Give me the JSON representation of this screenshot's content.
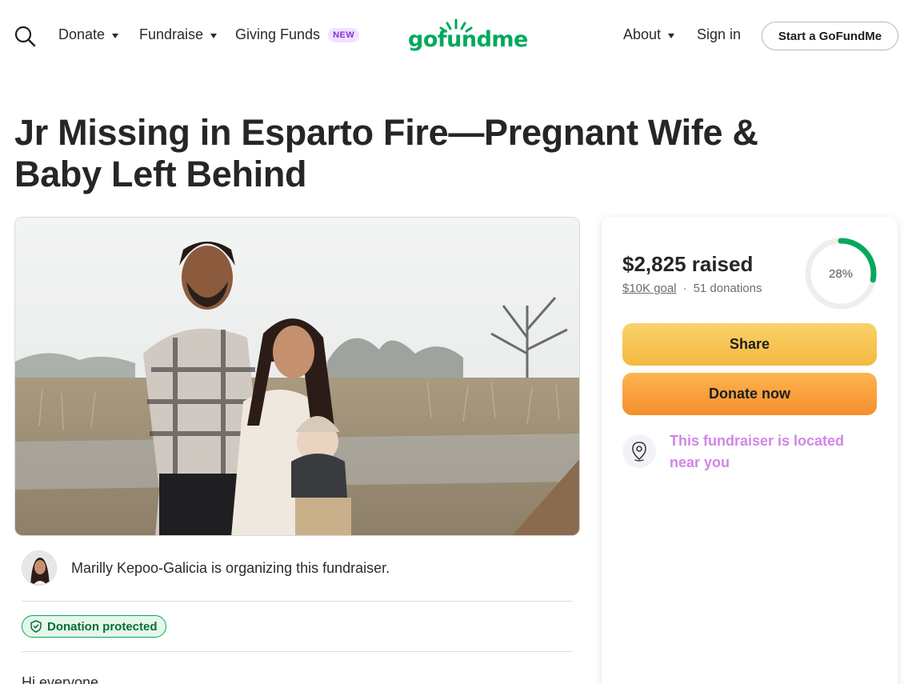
{
  "header": {
    "nav": {
      "donate": "Donate",
      "fundraise": "Fundraise",
      "giving_funds": "Giving Funds",
      "giving_funds_badge": "NEW",
      "about": "About",
      "sign_in": "Sign in"
    },
    "logo_text": "gofundme",
    "start_button": "Start a GoFundMe"
  },
  "campaign": {
    "title": "Jr Missing in Esparto Fire—Pregnant Wife & Baby Left Behind",
    "organizer_text": "Marilly Kepoo-Galicia is organizing this fundraiser.",
    "protection_badge": "Donation protected",
    "story_start": "Hi everyone"
  },
  "donation_card": {
    "raised": "$2,825 raised",
    "goal": "$10K goal",
    "separator": "·",
    "donations": "51 donations",
    "progress_label": "28%",
    "progress_fraction": 0.28,
    "share_button": "Share",
    "donate_button": "Donate now",
    "location_text": "This fundraiser is located near you"
  },
  "colors": {
    "brand_green": "#02a95c",
    "share_yellow": "#f4b941",
    "donate_orange": "#f48f2d",
    "location_purple": "#d086e8",
    "badge_purple": "#8a30d6"
  },
  "icons": {
    "search": "search-icon",
    "caret": "caret-down-icon",
    "shield": "shield-check-icon",
    "location": "map-pin-icon"
  }
}
